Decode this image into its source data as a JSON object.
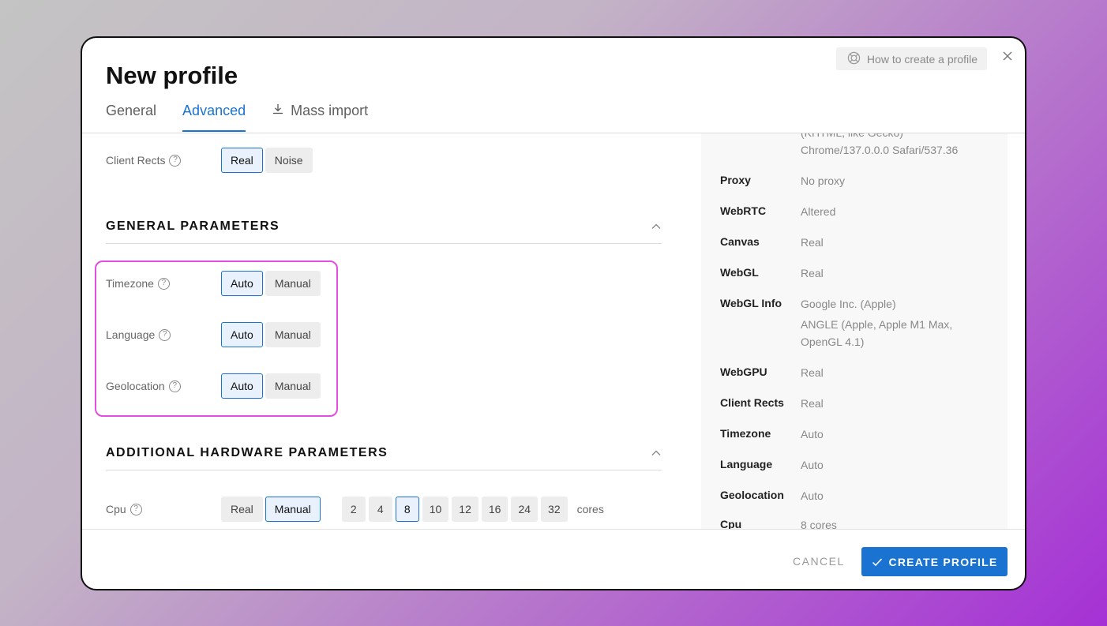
{
  "header": {
    "title": "New profile",
    "help_label": "How to create a profile",
    "help_icon": "lifebuoy-icon",
    "close_icon": "close-icon"
  },
  "tabs": [
    {
      "label": "General",
      "active": false
    },
    {
      "label": "Advanced",
      "active": true
    },
    {
      "label": "Mass import",
      "active": false,
      "icon": "download-icon"
    }
  ],
  "client_rects": {
    "label": "Client Rects",
    "options": [
      "Real",
      "Noise"
    ],
    "selected": "Real"
  },
  "general_parameters": {
    "title": "GENERAL PARAMETERS",
    "rows": [
      {
        "label": "Timezone",
        "options": [
          "Auto",
          "Manual"
        ],
        "selected": "Auto"
      },
      {
        "label": "Language",
        "options": [
          "Auto",
          "Manual"
        ],
        "selected": "Auto"
      },
      {
        "label": "Geolocation",
        "options": [
          "Auto",
          "Manual"
        ],
        "selected": "Auto"
      }
    ]
  },
  "additional_hardware": {
    "title": "ADDITIONAL HARDWARE PARAMETERS",
    "cpu": {
      "label": "Cpu",
      "options": [
        "Real",
        "Manual"
      ],
      "selected": "Manual",
      "cores": [
        "2",
        "4",
        "8",
        "10",
        "12",
        "16",
        "24",
        "32"
      ],
      "selected_core": "8",
      "unit": "cores"
    }
  },
  "summary": {
    "user_agent_tail": [
      "(KHTML, like Gecko)",
      "Chrome/137.0.0.0 Safari/537.36"
    ],
    "items": [
      {
        "key": "Proxy",
        "value": "No proxy"
      },
      {
        "key": "WebRTC",
        "value": "Altered"
      },
      {
        "key": "Canvas",
        "value": "Real"
      },
      {
        "key": "WebGL",
        "value": "Real"
      },
      {
        "key": "WebGL Info",
        "value": "Google Inc. (Apple)",
        "value2": "ANGLE (Apple, Apple M1 Max, OpenGL 4.1)"
      },
      {
        "key": "WebGPU",
        "value": "Real"
      },
      {
        "key": "Client Rects",
        "value": "Real"
      },
      {
        "key": "Timezone",
        "value": "Auto"
      },
      {
        "key": "Language",
        "value": "Auto"
      },
      {
        "key": "Geolocation",
        "value": "Auto"
      },
      {
        "key": "Cpu",
        "value": "8 cores"
      }
    ]
  },
  "footer": {
    "cancel_label": "CANCEL",
    "create_label": "CREATE PROFILE"
  },
  "colors": {
    "accent": "#1a73d0",
    "highlight": "#e14ee0"
  }
}
